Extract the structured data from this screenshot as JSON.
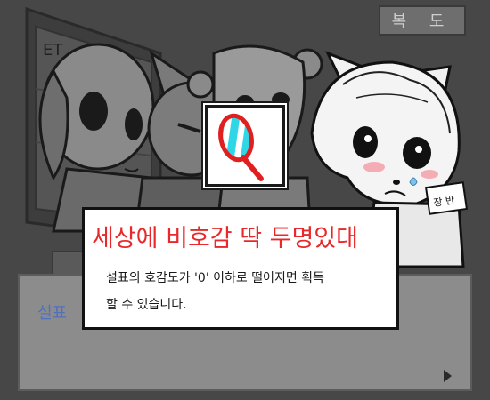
{
  "location": {
    "label": "복 도"
  },
  "dialog": {
    "speaker_partial": "설표"
  },
  "achievement": {
    "title": "세상에 비호감 딱 두명있대",
    "desc_line1": "설표의 호감도가 '0' 이하로 떨어지면 획득",
    "desc_line2": "할 수 있습니다.",
    "icon": "magnifier-icon",
    "colors": {
      "title": "#e8282a",
      "icon_ring": "#e02020",
      "icon_lens": "#2fd6e6"
    }
  },
  "background": {
    "sign_text": "ET",
    "nameplate_text": "장 반"
  }
}
